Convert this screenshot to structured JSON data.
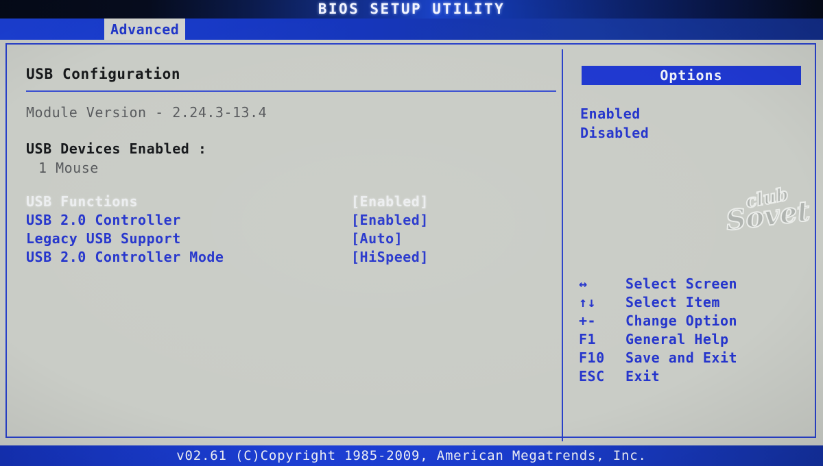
{
  "header": {
    "title": "BIOS SETUP UTILITY"
  },
  "menu": {
    "tabs": [
      {
        "label": "Advanced",
        "selected": true
      }
    ]
  },
  "main": {
    "section_title": "USB Configuration",
    "module_version": "Module Version - 2.24.3-13.4",
    "devices_header": "USB Devices Enabled :",
    "devices": [
      "1 Mouse"
    ],
    "settings": [
      {
        "label": "USB Functions",
        "value": "[Enabled]",
        "selected": true
      },
      {
        "label": "USB 2.0 Controller",
        "value": "[Enabled]",
        "selected": false
      },
      {
        "label": "Legacy USB Support",
        "value": "[Auto]",
        "selected": false
      },
      {
        "label": "USB 2.0 Controller Mode",
        "value": "[HiSpeed]",
        "selected": false
      }
    ]
  },
  "side": {
    "options_title": "Options",
    "options": [
      "Enabled",
      "Disabled"
    ],
    "legend": [
      {
        "key": "↔",
        "desc": "Select Screen"
      },
      {
        "key": "↑↓",
        "desc": "Select Item"
      },
      {
        "key": "+-",
        "desc": "Change Option"
      },
      {
        "key": "F1",
        "desc": "General Help"
      },
      {
        "key": "F10",
        "desc": "Save and Exit"
      },
      {
        "key": "ESC",
        "desc": "Exit"
      }
    ]
  },
  "watermark": {
    "line1": "club",
    "line2": "Sovet"
  },
  "footer": {
    "text": "v02.61 (C)Copyright 1985-2009, American Megatrends, Inc."
  },
  "colors": {
    "accent_blue": "#2434cc",
    "bar_blue": "#1b3fd4",
    "panel_gray": "#c9ccc6",
    "selected_text": "#eceef0",
    "heading_black": "#141619",
    "muted_gray": "#57595c"
  }
}
